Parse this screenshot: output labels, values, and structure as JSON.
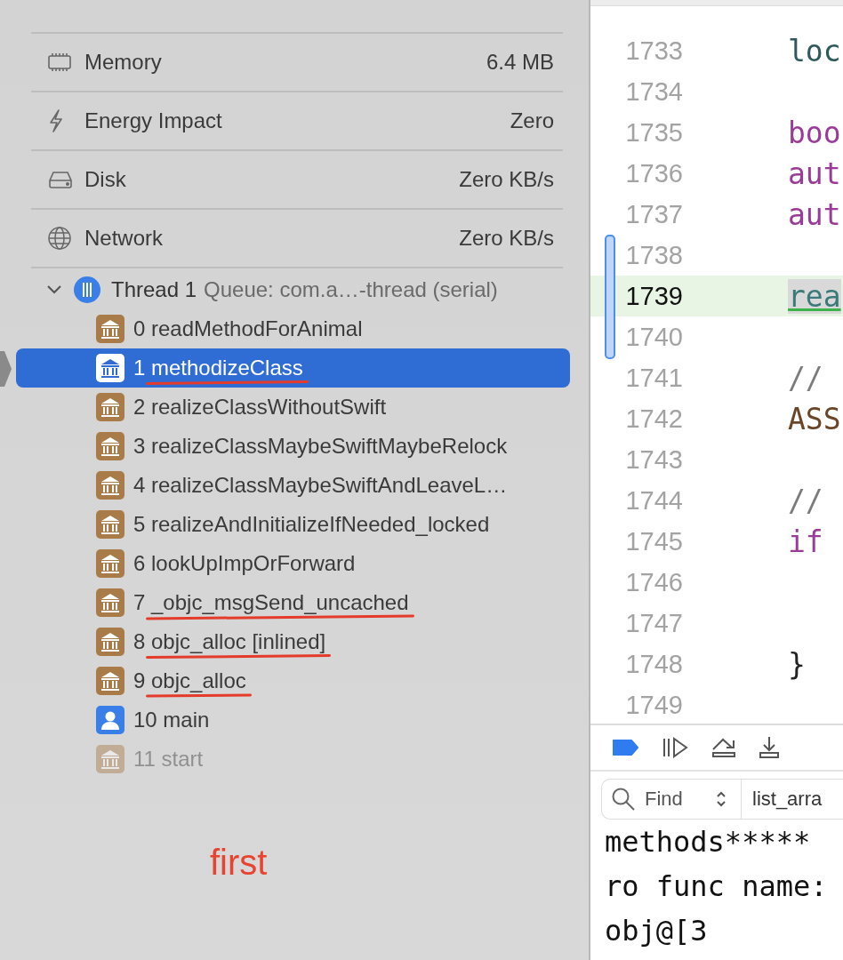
{
  "stats": [
    {
      "kind": "memory",
      "label": "Memory",
      "value": "6.4 MB"
    },
    {
      "kind": "energy",
      "label": "Energy Impact",
      "value": "Zero"
    },
    {
      "kind": "disk",
      "label": "Disk",
      "value": "Zero KB/s"
    },
    {
      "kind": "network",
      "label": "Network",
      "value": "Zero KB/s"
    }
  ],
  "thread": {
    "expanded": true,
    "name": "Thread 1",
    "queue": "Queue: com.a…-thread (serial)"
  },
  "frames": [
    {
      "label": "0 readMethodForAnimal",
      "kind": "library",
      "selected": false,
      "underlined": false,
      "dimmed": false
    },
    {
      "label": "1 methodizeClass",
      "kind": "library",
      "selected": true,
      "underlined": true,
      "dimmed": false
    },
    {
      "label": "2 realizeClassWithoutSwift",
      "kind": "library",
      "selected": false,
      "underlined": false,
      "dimmed": false
    },
    {
      "label": "3 realizeClassMaybeSwiftMaybeRelock",
      "kind": "library",
      "selected": false,
      "underlined": false,
      "dimmed": false
    },
    {
      "label": "4 realizeClassMaybeSwiftAndLeaveL…",
      "kind": "library",
      "selected": false,
      "underlined": false,
      "dimmed": false
    },
    {
      "label": "5 realizeAndInitializeIfNeeded_locked",
      "kind": "library",
      "selected": false,
      "underlined": false,
      "dimmed": false
    },
    {
      "label": "6 lookUpImpOrForward",
      "kind": "library",
      "selected": false,
      "underlined": false,
      "dimmed": false
    },
    {
      "label": "7 _objc_msgSend_uncached",
      "kind": "library",
      "selected": false,
      "underlined": true,
      "dimmed": false
    },
    {
      "label": "8 objc_alloc [inlined]",
      "kind": "library",
      "selected": false,
      "underlined": true,
      "dimmed": false
    },
    {
      "label": "9 objc_alloc",
      "kind": "library",
      "selected": false,
      "underlined": true,
      "dimmed": false
    },
    {
      "label": "10 main",
      "kind": "user",
      "selected": false,
      "underlined": false,
      "dimmed": false
    },
    {
      "label": "11 start",
      "kind": "library",
      "selected": false,
      "underlined": false,
      "dimmed": true
    }
  ],
  "annotation": "first",
  "editor": {
    "lines": [
      {
        "number": "1733",
        "code": "loc",
        "kind": "ident",
        "current": false
      },
      {
        "number": "1734",
        "current": false
      },
      {
        "number": "1735",
        "code": "boo",
        "kind": "keyword",
        "current": false
      },
      {
        "number": "1736",
        "code": "aut",
        "kind": "keyword",
        "current": false
      },
      {
        "number": "1737",
        "code": "aut",
        "kind": "keyword",
        "current": false
      },
      {
        "number": "1738",
        "current": false
      },
      {
        "number": "1739",
        "code": "rea",
        "kind": "call",
        "current": true
      },
      {
        "number": "1740",
        "current": false
      },
      {
        "number": "1741",
        "code": "//",
        "kind": "comment",
        "current": false
      },
      {
        "number": "1742",
        "code": "ASS",
        "kind": "macro",
        "current": false
      },
      {
        "number": "1743",
        "current": false
      },
      {
        "number": "1744",
        "code": "//",
        "kind": "comment",
        "current": false
      },
      {
        "number": "1745",
        "code": "if",
        "kind": "keyword",
        "current": false
      },
      {
        "number": "1746",
        "current": false
      },
      {
        "number": "1747",
        "current": false
      },
      {
        "number": "1748",
        "code": "}",
        "kind": "plain",
        "current": false
      },
      {
        "number": "1749",
        "current": false
      }
    ]
  },
  "debug_bar": {
    "breakpoints_active": true
  },
  "console": {
    "filter": {
      "placeholder": "Find"
    },
    "scope": "list_arra",
    "lines": [
      "methods*****",
      "ro func name:",
      "obj@[3"
    ]
  }
}
